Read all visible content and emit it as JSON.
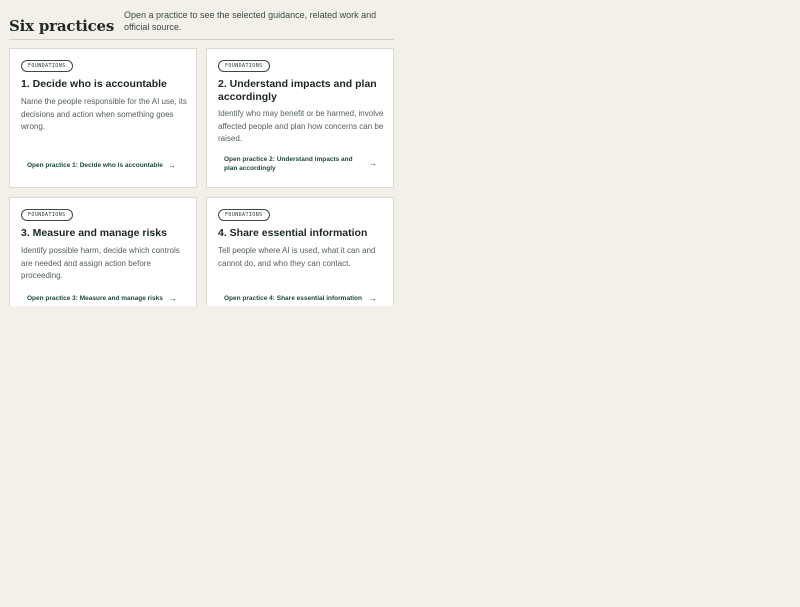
{
  "section": {
    "title": "Six practices",
    "intro": "Open a practice to see the selected guidance, related work and official source."
  },
  "cards": [
    {
      "tag": "FOUNDATIONS",
      "title": "1. Decide who is accountable",
      "description": "Name the people responsible for the AI use, its decisions and action when something goes wrong.",
      "link": "Open practice 1: Decide who is accountable"
    },
    {
      "tag": "FOUNDATIONS",
      "title": "2. Understand impacts and plan accordingly",
      "description": "Identify who may benefit or be harmed, involve affected people and plan how concerns can be raised.",
      "link": "Open practice 2: Understand impacts and plan accordingly"
    },
    {
      "tag": "FOUNDATIONS",
      "title": "3. Measure and manage risks",
      "description": "Identify possible harm, decide which controls are needed and assign action before proceeding.",
      "link": "Open practice 3: Measure and manage risks"
    },
    {
      "tag": "FOUNDATIONS",
      "title": "4. Share essential information",
      "description": "Tell people where AI is used, what it can and cannot do, and who they can contact.",
      "link": "Open practice 4: Share essential information"
    }
  ],
  "icons": {
    "arrow": "→"
  },
  "colors": {
    "background": "#f3f0ea",
    "card": "#ffffff",
    "link": "#1e4a36"
  }
}
